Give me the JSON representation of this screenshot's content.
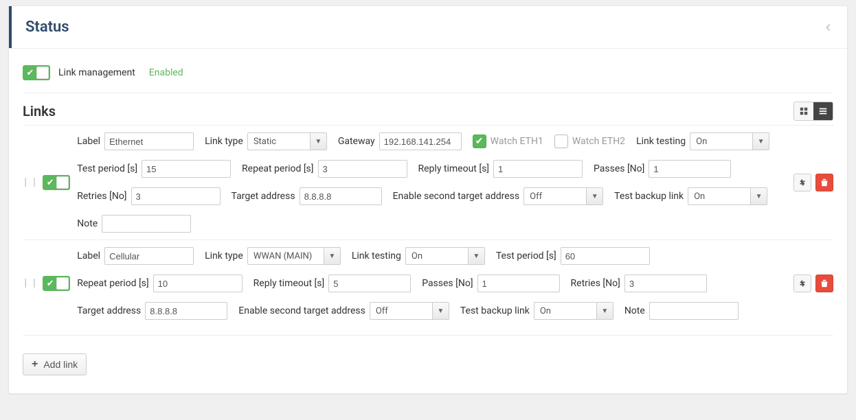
{
  "header": {
    "title": "Status"
  },
  "link_management": {
    "label": "Link management",
    "status": "Enabled"
  },
  "links_section": {
    "title": "Links",
    "add_button": "Add link"
  },
  "labels": {
    "label": "Label",
    "link_type": "Link type",
    "gateway": "Gateway",
    "watch_eth1": "Watch ETH1",
    "watch_eth2": "Watch ETH2",
    "link_testing": "Link testing",
    "test_period": "Test period [s]",
    "repeat_period": "Repeat period [s]",
    "reply_timeout": "Reply timeout [s]",
    "passes": "Passes [No]",
    "retries": "Retries [No]",
    "target_address": "Target address",
    "enable_second_target": "Enable second target address",
    "test_backup_link": "Test backup link",
    "note": "Note"
  },
  "links": [
    {
      "enabled": true,
      "label": "Ethernet",
      "link_type": "Static",
      "gateway": "192.168.141.254",
      "watch_eth1": true,
      "watch_eth2": false,
      "link_testing": "On",
      "test_period": "15",
      "repeat_period": "3",
      "reply_timeout": "1",
      "passes": "1",
      "retries": "3",
      "target_address": "8.8.8.8",
      "enable_second_target": "Off",
      "test_backup_link": "On",
      "note": ""
    },
    {
      "enabled": true,
      "label": "Cellular",
      "link_type": "WWAN (MAIN)",
      "link_testing": "On",
      "test_period": "60",
      "repeat_period": "10",
      "reply_timeout": "5",
      "passes": "1",
      "retries": "3",
      "target_address": "8.8.8.8",
      "enable_second_target": "Off",
      "test_backup_link": "On",
      "note": ""
    }
  ]
}
